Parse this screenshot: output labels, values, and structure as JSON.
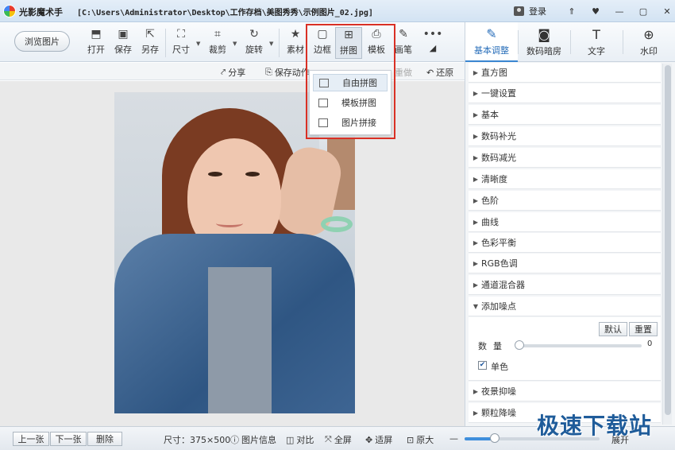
{
  "titlebar": {
    "app_name": "光影魔术手",
    "path": "[C:\\Users\\Administrator\\Desktop\\工作存档\\美图秀秀\\示例图片_02.jpg]",
    "login_label": "登录",
    "buttons": [
      "⇑",
      "♥",
      "—",
      "▢",
      "✕"
    ]
  },
  "toolbar": {
    "browse_label": "浏览图片",
    "tools": [
      {
        "label": "打开",
        "icon": "open-icon"
      },
      {
        "label": "保存",
        "icon": "save-icon"
      },
      {
        "label": "另存",
        "icon": "save-as-icon"
      },
      {
        "label": "尺寸",
        "icon": "resize-icon"
      },
      {
        "label": "裁剪",
        "icon": "crop-icon"
      },
      {
        "label": "旋转",
        "icon": "rotate-icon"
      },
      {
        "label": "素材",
        "icon": "material-icon"
      },
      {
        "label": "边框",
        "icon": "frame-icon"
      },
      {
        "label": "拼图",
        "icon": "collage-icon"
      },
      {
        "label": "模板",
        "icon": "template-icon"
      },
      {
        "label": "画笔",
        "icon": "brush-icon"
      },
      {
        "label": "•••",
        "icon": "more-icon"
      }
    ]
  },
  "subbar": {
    "share": "分享",
    "save_action": "保存动作",
    "redo": "重做",
    "restore": "还原"
  },
  "collage_menu": {
    "items": [
      "自由拼图",
      "模板拼图",
      "图片拼接"
    ]
  },
  "right_tabs": [
    {
      "label": "基本调整",
      "icon": "edit-icon"
    },
    {
      "label": "数码暗房",
      "icon": "camera-icon"
    },
    {
      "label": "文字",
      "icon": "text-icon"
    },
    {
      "label": "水印",
      "icon": "watermark-icon"
    }
  ],
  "adjust_list": [
    "直方图",
    "一键设置",
    "基本",
    "数码补光",
    "数码减光",
    "清晰度",
    "色阶",
    "曲线",
    "色彩平衡",
    "RGB色调",
    "通道混合器",
    "添加噪点"
  ],
  "noise_panel": {
    "default_btn": "默认",
    "reset_btn": "重置",
    "amount_label": "数量",
    "amount_value": "0",
    "mono_label": "单色",
    "mono_checked": "✔"
  },
  "adjust_list_bottom": [
    "夜景抑噪",
    "颗粒降噪"
  ],
  "statusbar": {
    "prev": "上一张",
    "next": "下一张",
    "delete": "删除",
    "size": "尺寸：375×500",
    "info": "图片信息",
    "compare": "对比",
    "fullscreen": "全屏",
    "fit": "适屏",
    "original": "原大",
    "zoom_fraction": 0.2,
    "expand": "展开"
  },
  "watermark_text": "极速下载站"
}
